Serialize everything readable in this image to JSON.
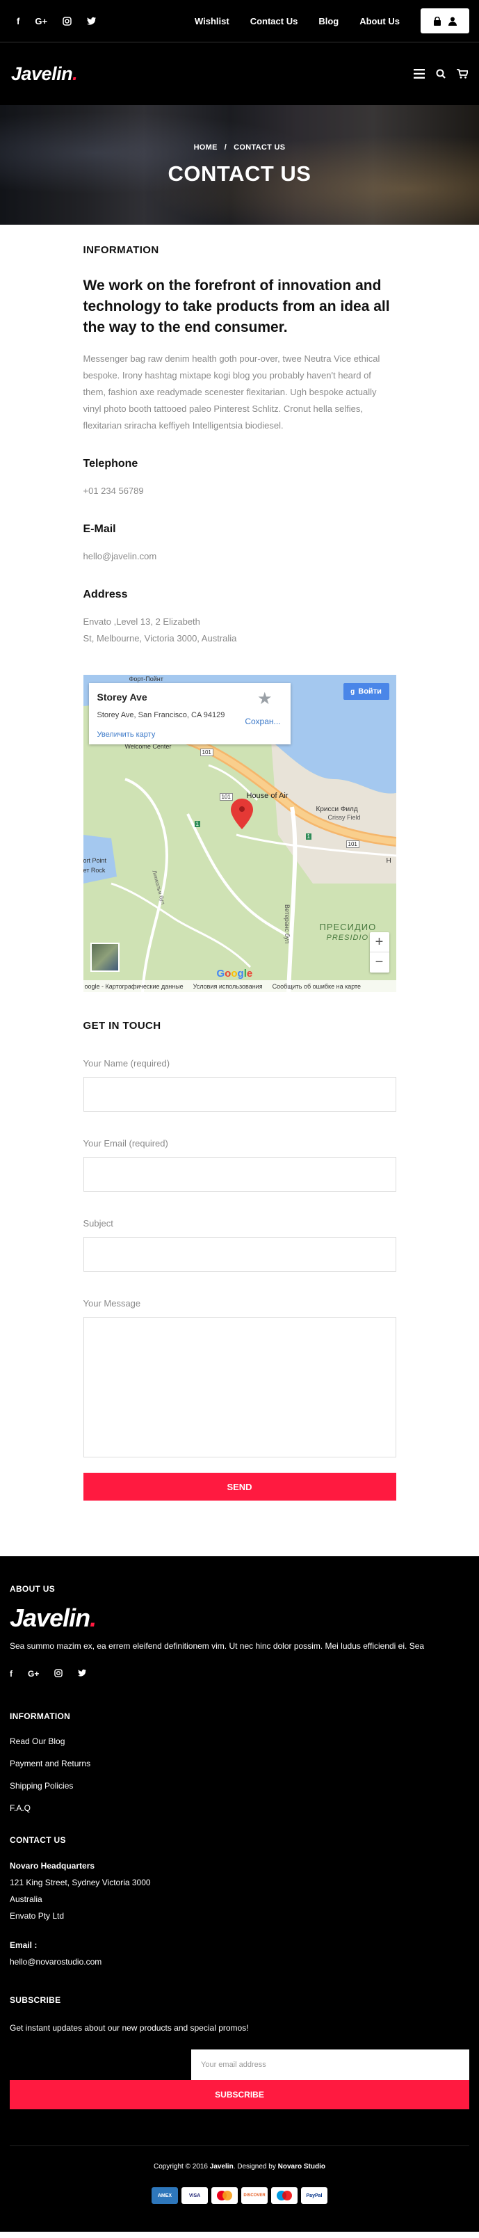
{
  "topbar": {
    "social_icons": [
      "facebook-icon",
      "google-plus-icon",
      "instagram-icon",
      "twitter-icon"
    ],
    "nav": [
      "Wishlist",
      "Contact Us",
      "Blog",
      "About Us"
    ]
  },
  "header": {
    "logo": "Javelin",
    "logo_dot": "."
  },
  "hero": {
    "breadcrumb_home": "HOME",
    "breadcrumb_sep": "/",
    "breadcrumb_current": "CONTACT US",
    "title": "CONTACT US"
  },
  "info": {
    "label": "INFORMATION",
    "lead": "We work on the forefront of innovation and technology to take products from an idea all the way to the end consumer.",
    "paragraph": "Messenger bag raw denim health goth pour-over, twee Neutra Vice ethical bespoke. Irony hashtag mixtape kogi blog you probably haven't heard of them, fashion axe readymade scenester flexitarian. Ugh bespoke actually vinyl photo booth tattooed paleo Pinterest Schlitz. Cronut hella selfies, flexitarian sriracha keffiyeh Intelligentsia biodiesel.",
    "telephone_label": "Telephone",
    "telephone": "+01 234 56789",
    "email_label": "E-Mail",
    "email": "hello@javelin.com",
    "address_label": "Address",
    "address_line1": "Envato ,Level 13, 2 Elizabeth",
    "address_line2": "St, Melbourne, Victoria 3000, Australia"
  },
  "map": {
    "place": "Storey Ave",
    "address": "Storey Ave, San Francisco, CA 94129",
    "save": "Сохран...",
    "bigger": "Увеличить карту",
    "signin": "Войти",
    "labels": {
      "fort_point": "Форт-Пойнт",
      "welcome": "Welcome Center",
      "house_of_air": "House of Air",
      "crissy": "Крисси Филд",
      "crissy_en": "Crissy Field",
      "presidio": "ПРЕСИДИО",
      "presidio_en": "PRESIDIO",
      "ft_rock": "ет Rock",
      "ft_point": "ort Point",
      "lincoln": "Линкольн бул",
      "veterans": "Ветеранс бул",
      "route_101a": "101",
      "route_101b": "101",
      "route_101c": "101",
      "route_4a": "1",
      "route_4b": "1",
      "route_h": "H"
    },
    "zoom_in": "+",
    "zoom_out": "−",
    "footer": [
      "oogle - Картографические данные",
      "Условия использования",
      "Сообщить об ошибке на карте"
    ],
    "google": "Google"
  },
  "form": {
    "title": "GET IN TOUCH",
    "name_label": "Your Name (required)",
    "email_label": "Your Email (required)",
    "subject_label": "Subject",
    "message_label": "Your Message",
    "send": "SEND"
  },
  "footer": {
    "about_title": "ABOUT US",
    "logo": "Javelin",
    "logo_dot": ".",
    "about_text": "Sea summo mazim ex, ea errem eleifend definitionem vim. Ut nec hinc dolor possim. Mei ludus efficiendi ei. Sea",
    "social_icons": [
      "facebook-icon",
      "google-plus-icon",
      "instagram-icon",
      "twitter-icon"
    ],
    "info_title": "INFORMATION",
    "info_links": [
      "Read Our Blog",
      "Payment and Returns",
      "Shipping Policies",
      "F.A.Q"
    ],
    "contact_title": "CONTACT US",
    "hq": "Novaro Headquarters",
    "addr1": "121 King Street, Sydney Victoria 3000",
    "addr2": "Australia",
    "addr3": "Envato Pty Ltd",
    "email_label": "Email :",
    "email": "hello@novarostudio.com",
    "subscribe_title": "SUBSCRIBE",
    "subscribe_text": "Get instant updates about our new products and special promos!",
    "email_placeholder": "Your email address",
    "subscribe_btn": "SUBSCRIBE",
    "copy_prefix": "Copyright © 2016",
    "copy_brand": "Javelin",
    "copy_mid": ". Designed by",
    "copy_studio": "Novaro Studio",
    "payments": [
      "AMEX",
      "VISA",
      "MC",
      "DISCOVER",
      "MAESTRO",
      "PayPal"
    ]
  },
  "colors": {
    "accent": "#ff1a40",
    "dark": "#000000",
    "muted": "#8a8a8a"
  }
}
